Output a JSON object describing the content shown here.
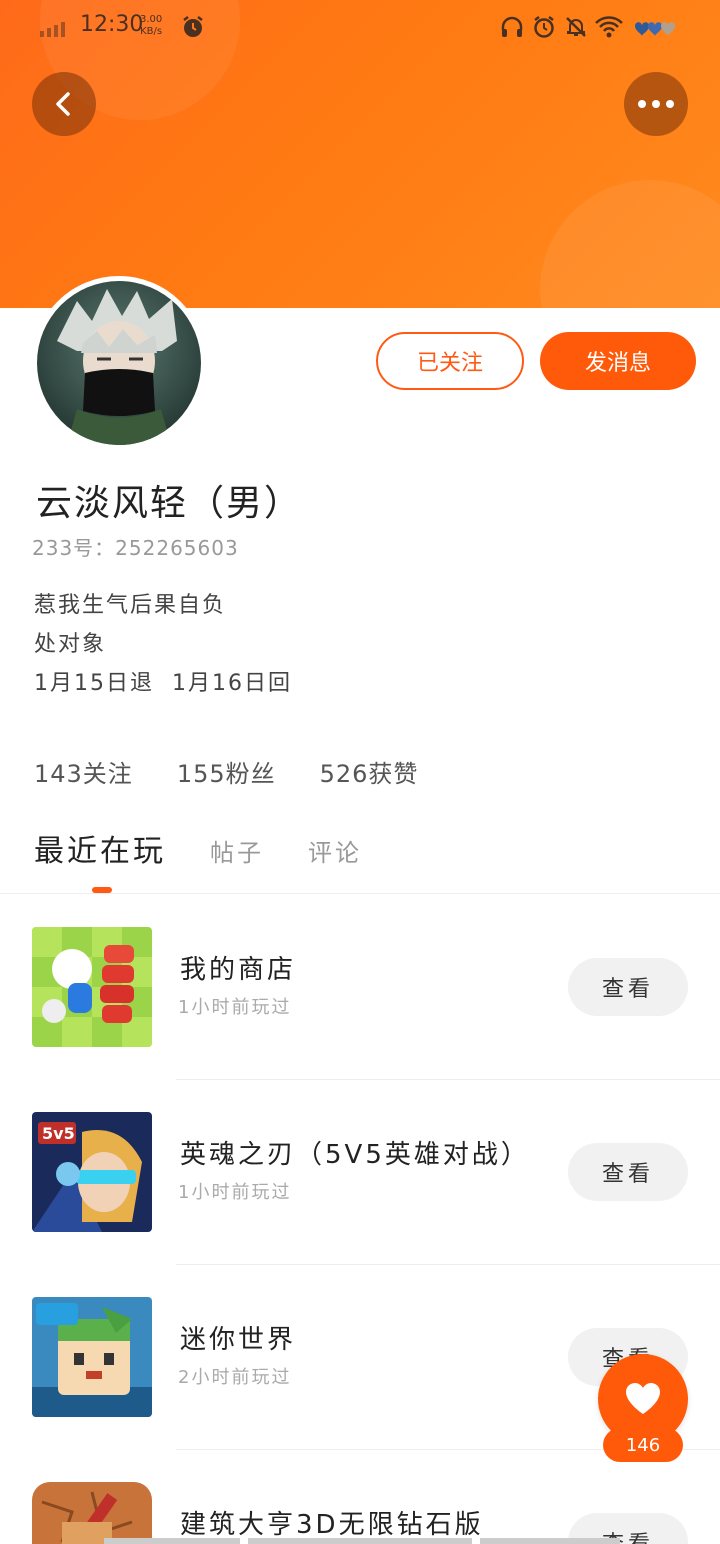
{
  "status_bar": {
    "time": "12:30",
    "net_speed_value": "3.00",
    "net_speed_unit": "KB/s",
    "icons": [
      "signal-icon",
      "alarm-icon",
      "headphones-icon",
      "alarm-icon",
      "mute-bell-icon",
      "wifi-icon",
      "battery-icon"
    ]
  },
  "header": {
    "back_icon": "back-arrow-icon",
    "more_icon": "more-dots-icon"
  },
  "profile": {
    "follow_label": "已关注",
    "message_label": "发消息",
    "name": "云淡风轻（男）",
    "id_text": "233号：252265603",
    "bio_lines": [
      "惹我生气后果自负",
      "处对象",
      "1月15日退  1月16日回"
    ],
    "stats": {
      "following": "143关注",
      "fans": "155粉丝",
      "likes": "526获赞"
    }
  },
  "tabs": [
    {
      "label": "最近在玩",
      "active": true
    },
    {
      "label": "帖子",
      "active": false
    },
    {
      "label": "评论",
      "active": false
    }
  ],
  "games": [
    {
      "name": "我的商店",
      "time": "1小时前玩过",
      "button": "查看"
    },
    {
      "name": "英魂之刃（5V5英雄对战）",
      "time": "1小时前玩过",
      "button": "查看"
    },
    {
      "name": "迷你世界",
      "time": "2小时前玩过",
      "button": "查看"
    },
    {
      "name": "建筑大亨3D无限钻石版",
      "time": "",
      "button": "查看"
    }
  ],
  "like_fab": {
    "count": "146",
    "icon": "heart-icon"
  },
  "colors": {
    "accent": "#ff5a0a",
    "banner_start": "#ff6a1a",
    "banner_end": "#ff8a1e"
  }
}
